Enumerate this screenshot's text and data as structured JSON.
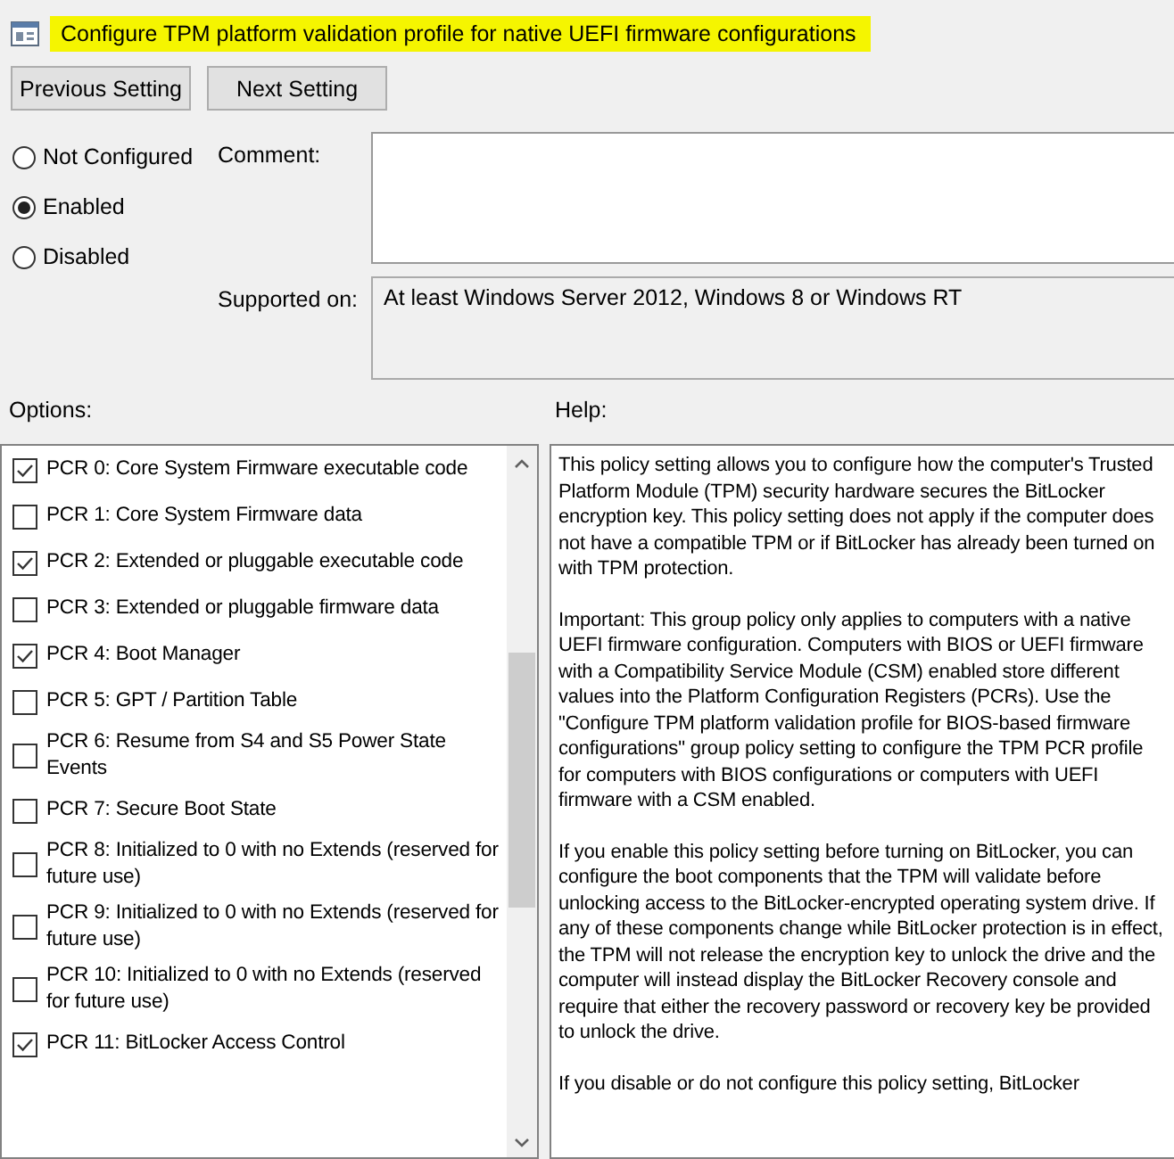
{
  "title": "Configure TPM platform validation profile for native UEFI firmware configurations",
  "nav_buttons": [
    "Previous Setting",
    "Next Setting"
  ],
  "state_options": [
    {
      "label": "Not Configured",
      "selected": false
    },
    {
      "label": "Enabled",
      "selected": true
    },
    {
      "label": "Disabled",
      "selected": false
    }
  ],
  "comment": {
    "label": "Comment:"
  },
  "supported_on": {
    "label": "Supported on:",
    "value": "At least Windows Server 2012, Windows 8 or Windows RT"
  },
  "options": {
    "label": "Options:",
    "items": [
      {
        "label": "PCR 0: Core System Firmware executable code",
        "checked": true
      },
      {
        "label": "PCR 1: Core System Firmware data",
        "checked": false
      },
      {
        "label": "PCR 2: Extended or pluggable executable code",
        "checked": true
      },
      {
        "label": "PCR 3: Extended or pluggable firmware data",
        "checked": false
      },
      {
        "label": "PCR 4: Boot Manager",
        "checked": true
      },
      {
        "label": "PCR 5: GPT / Partition Table",
        "checked": false
      },
      {
        "label": "PCR 6: Resume from S4 and S5 Power State Events",
        "checked": false
      },
      {
        "label": "PCR 7: Secure Boot State",
        "checked": false
      },
      {
        "label": "PCR 8: Initialized to 0 with no Extends (reserved for future use)",
        "checked": false
      },
      {
        "label": "PCR 9: Initialized to 0 with no Extends (reserved for future use)",
        "checked": false
      },
      {
        "label": "PCR 10: Initialized to 0 with no Extends (reserved for future use)",
        "checked": false
      },
      {
        "label": "PCR 11: BitLocker Access Control",
        "checked": true
      }
    ]
  },
  "help": {
    "label": "Help:",
    "paragraphs": [
      "This policy setting allows you to configure how the computer's Trusted Platform Module (TPM) security hardware secures the BitLocker encryption key. This policy setting does not apply if the computer does not have a compatible TPM or if BitLocker has already been turned on with TPM protection.",
      "Important: This group policy only applies to computers with a native UEFI firmware configuration. Computers with BIOS or UEFI firmware with a Compatibility Service Module (CSM) enabled store different values into the Platform Configuration Registers (PCRs). Use the \"Configure TPM platform validation profile for BIOS-based firmware configurations\" group policy setting to configure the TPM PCR profile for computers with BIOS configurations or computers with UEFI firmware with a CSM enabled.",
      "If you enable this policy setting before turning on BitLocker, you can configure the boot components that the TPM will validate before unlocking access to the BitLocker-encrypted operating system drive. If any of these components change while BitLocker protection is in effect, the TPM will not release the encryption key to unlock the drive and the computer will instead display the BitLocker Recovery console and require that either the recovery password or recovery key be provided to unlock the drive.",
      "If you disable or do not configure this policy setting, BitLocker"
    ]
  }
}
